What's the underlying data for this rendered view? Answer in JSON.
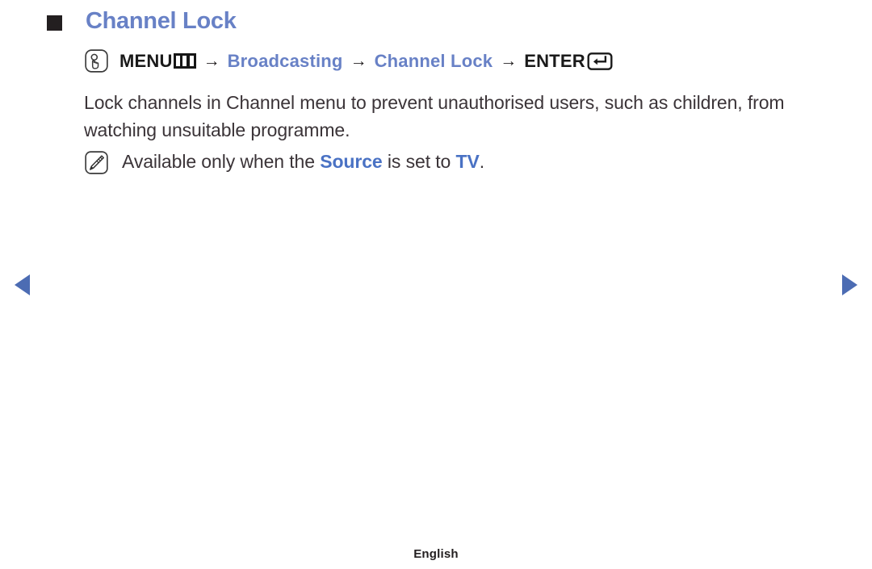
{
  "heading": {
    "bullet_icon": "black-square-bullet",
    "title": "Channel Lock",
    "color": "#6881c6"
  },
  "menu_path": {
    "press_icon": "press-button-hand-icon",
    "menu_label": "MENU",
    "menu_icon": "menu-bars-icon",
    "arrow": "→",
    "step_broadcasting": "Broadcasting",
    "step_channel_lock": "Channel Lock",
    "enter_label": "ENTER",
    "enter_icon": "enter-return-key-icon",
    "accent_color": "#6881c6"
  },
  "body": {
    "paragraph": "Lock channels in Channel menu to prevent unauthorised users, such as children, from watching unsuitable programme."
  },
  "note": {
    "note_icon": "note-pencil-icon",
    "prefix": "Available only when the ",
    "highlight_source": "Source",
    "middle": " is set to ",
    "highlight_tv": "TV",
    "suffix": ".",
    "highlight_color": "#4a72c4"
  },
  "navigation": {
    "prev_icon": "triangle-left-icon",
    "next_icon": "triangle-right-icon",
    "arrow_color": "#4c6cb3"
  },
  "footer": {
    "language": "English"
  }
}
